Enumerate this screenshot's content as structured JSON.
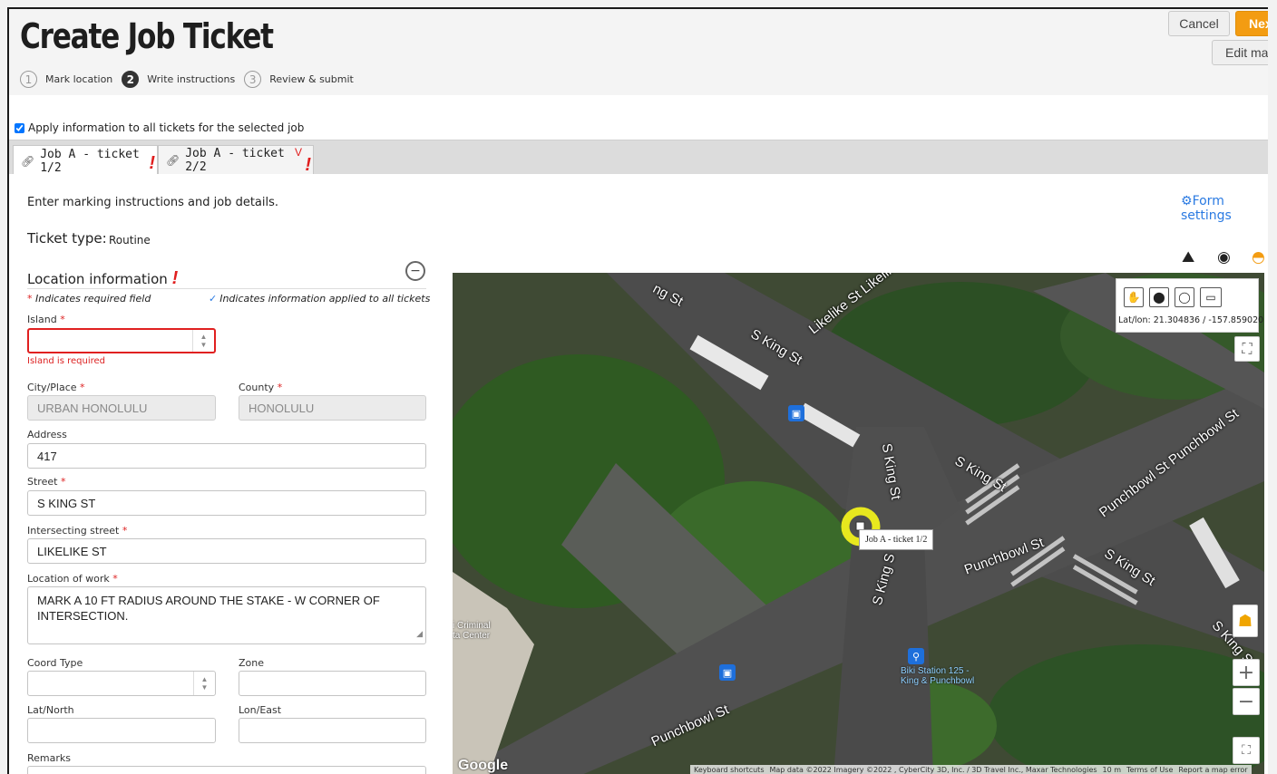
{
  "header": {
    "title": "Create Job Ticket",
    "steps": [
      {
        "num": "1",
        "label": "Mark location"
      },
      {
        "num": "2",
        "label": "Write instructions"
      },
      {
        "num": "3",
        "label": "Review & submit"
      }
    ],
    "cancel_label": "Cancel",
    "next_label": "Nex",
    "edit_label": "Edit ma"
  },
  "apply_all": {
    "label": "Apply information to all tickets for the selected job",
    "checked": true
  },
  "tabs": [
    {
      "label": "Job A - ticket 1/2",
      "error_mark": "!"
    },
    {
      "label": "Job A - ticket 2/2",
      "error_mark": "!",
      "v_mark": "V"
    }
  ],
  "intro_text": "Enter marking instructions and job details.",
  "form_settings_label": "Form settings",
  "ticket_type": {
    "label": "Ticket type:",
    "value": "Routine"
  },
  "location_section": {
    "title": "Location information",
    "error_mark": "!",
    "collapse_symbol": "−",
    "required_note_star": "*",
    "required_note": "Indicates required field",
    "applied_note": "Indicates information applied to all tickets"
  },
  "fields": {
    "island": {
      "label": "Island",
      "value": "",
      "error": "Island is required"
    },
    "city": {
      "label": "City/Place",
      "value": "URBAN HONOLULU"
    },
    "county": {
      "label": "County",
      "value": "HONOLULU"
    },
    "address": {
      "label": "Address",
      "value": "417"
    },
    "street": {
      "label": "Street",
      "value": "S KING ST"
    },
    "intersecting": {
      "label": "Intersecting street",
      "value": "LIKELIKE ST"
    },
    "location_of_work": {
      "label": "Location of work",
      "value": "MARK A 10 FT RADIUS AROUND THE STAKE - W CORNER OF INTERSECTION."
    },
    "coord_type": {
      "label": "Coord Type",
      "value": ""
    },
    "zone": {
      "label": "Zone",
      "value": ""
    },
    "lat_north": {
      "label": "Lat/North",
      "value": ""
    },
    "lon_east": {
      "label": "Lon/East",
      "value": ""
    },
    "remarks": {
      "label": "Remarks",
      "value": ""
    }
  },
  "map": {
    "latlon": "Lat/lon: 21.304836 / -157.859020",
    "marker_popup": "Job A - ticket 1/2",
    "street_labels": {
      "king_top": "S King St",
      "likelike": "Likelike St Likelil",
      "king_vert1": "S King St",
      "king_right": "S King St",
      "punchbowl_right": "Punchbowl St Punchbowl St",
      "punchbowl_mid": "Punchbowl St",
      "king_vert2": "S King S",
      "king_far": "S King St",
      "punchbowl_bottom": "Punchbowl St",
      "king_edge": "S King St",
      "king_topleft": "ng St"
    },
    "poi": {
      "criminal_center": "i Criminal\nta Center",
      "biki": "Biki Station 125 -\nKing & Punchbowl"
    },
    "google": "Google",
    "attribution": [
      "Keyboard shortcuts",
      "Map data ©2022 Imagery ©2022 , CyberCity 3D, Inc. / 3D Travel Inc., Maxar Technologies",
      "10 m",
      "Terms of Use",
      "Report a map error"
    ],
    "colors": {
      "marker": "#e8e81e",
      "road": "#4a4a4a"
    }
  }
}
